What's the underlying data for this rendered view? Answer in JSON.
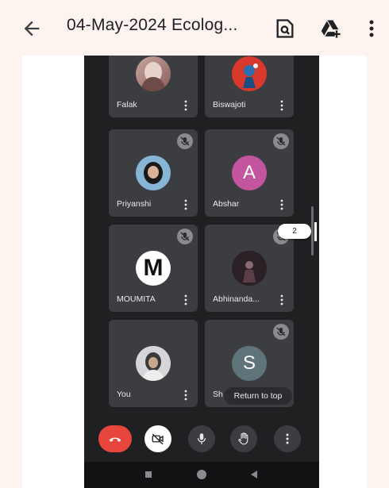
{
  "appbar": {
    "title": "04-May-2024 Ecolog...",
    "icons": [
      "back-arrow-icon",
      "find-in-page-icon",
      "add-to-drive-icon",
      "more-vert-icon"
    ]
  },
  "participants": [
    {
      "name": "Falak",
      "avatar": "photo",
      "muted": false
    },
    {
      "name": "Biswajoti",
      "avatar": "photo",
      "muted": false
    },
    {
      "name": "Priyanshi",
      "avatar": "photo",
      "muted": true
    },
    {
      "name": "Abshar",
      "avatar": "letter",
      "letter": "A",
      "color": "#c2559d",
      "muted": true
    },
    {
      "name": "MOUMITA",
      "avatar": "logo",
      "letter": "M",
      "muted": true
    },
    {
      "name": "Abhinanda...",
      "avatar": "photo",
      "muted": true
    },
    {
      "name": "You",
      "avatar": "photo",
      "muted": false
    },
    {
      "name": "Sh",
      "avatar": "letter",
      "letter": "S",
      "color": "#5f7478",
      "muted": true
    }
  ],
  "page_indicator": "2",
  "return_to_top": "Return to top",
  "controls": [
    "end-call-icon",
    "camera-off-icon",
    "mic-icon",
    "raise-hand-icon",
    "more-vert-icon"
  ],
  "colors": {
    "background": "#fdf3ef",
    "meet_bg": "#1f2022",
    "tile_bg": "#3c3d41",
    "end_call": "#e8453c"
  }
}
